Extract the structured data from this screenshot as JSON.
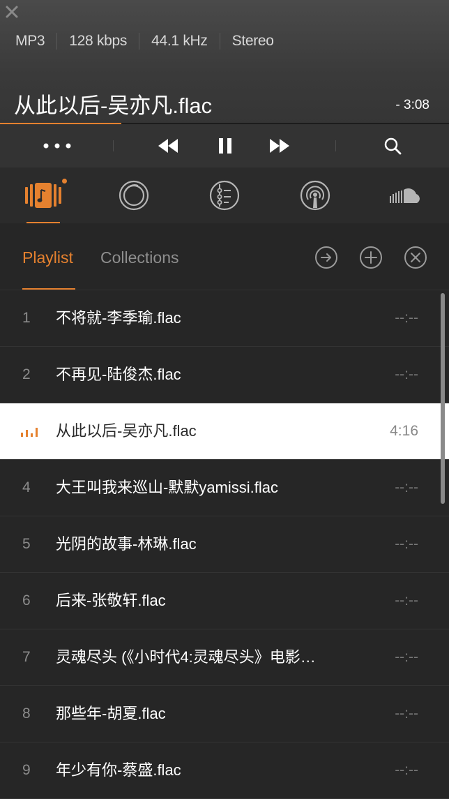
{
  "header": {
    "format": "MP3",
    "bitrate": "128 kbps",
    "sample_rate": "44.1 kHz",
    "channels": "Stereo",
    "title": "从此以后-吴亦凡.flac",
    "remaining": "- 3:08",
    "progress": 0.27
  },
  "transport": {
    "more_icon": "more-dots-icon",
    "prev_icon": "rewind-icon",
    "pause_icon": "pause-icon",
    "next_icon": "fast-forward-icon",
    "search_icon": "search-icon"
  },
  "nav": {
    "items": [
      "music-playlist-icon",
      "radio-circle-icon",
      "equalizer-list-icon",
      "podcast-icon",
      "soundcloud-icon"
    ]
  },
  "tabs": {
    "playlist": "Playlist",
    "collections": "Collections"
  },
  "actions": [
    "go-arrow-icon",
    "add-icon",
    "clear-icon"
  ],
  "colors": {
    "accent": "#e5812f",
    "background": "#262626"
  },
  "playlist": [
    {
      "num": "1",
      "name": "不将就-李季瑜.flac",
      "duration": "--:--"
    },
    {
      "num": "2",
      "name": "不再见-陆俊杰.flac",
      "duration": "--:--"
    },
    {
      "num": "3",
      "name": "从此以后-吴亦凡.flac",
      "duration": "4:16",
      "playing": true
    },
    {
      "num": "4",
      "name": "大王叫我来巡山-默默yamissi.flac",
      "duration": "--:--"
    },
    {
      "num": "5",
      "name": "光阴的故事-林琳.flac",
      "duration": "--:--"
    },
    {
      "num": "6",
      "name": "后来-张敬轩.flac",
      "duration": "--:--"
    },
    {
      "num": "7",
      "name": "灵魂尽头 (《小时代4:灵魂尽头》电影…",
      "duration": "--:--"
    },
    {
      "num": "8",
      "name": "那些年-胡夏.flac",
      "duration": "--:--"
    },
    {
      "num": "9",
      "name": "年少有你-蔡盛.flac",
      "duration": "--:--"
    }
  ]
}
